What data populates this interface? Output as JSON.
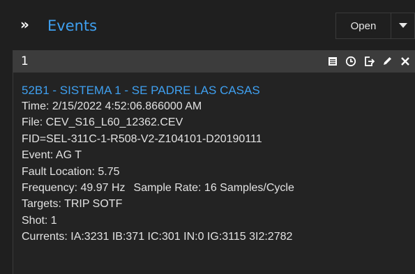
{
  "header": {
    "title": "Events",
    "open_label": "Open"
  },
  "panel": {
    "number": "1",
    "heading": "52B1 - SISTEMA 1 - SE PADRE LAS CASAS",
    "time": "Time:  2/15/2022 4:52:06.866000 AM",
    "file": "File: CEV_S16_L60_12362.CEV",
    "fid": "FID=SEL-311C-1-R508-V2-Z104101-D20190111",
    "event": "Event: AG T",
    "fault_location": "Fault Location: 5.75",
    "frequency": "Frequency: 49.97 Hz",
    "sample_rate": "Sample Rate: 16 Samples/Cycle",
    "targets": "Targets: TRIP SOTF",
    "shot": "Shot: 1",
    "currents": "Currents: IA:3231 IB:371 IC:301 IN:0 IG:3115 3I2:2782"
  },
  "icons": {
    "expand": "double-chevron-right-icon",
    "caret": "caret-down-icon",
    "tools": [
      "table-icon",
      "clock-icon",
      "export-icon",
      "edit-icon",
      "close-icon"
    ]
  },
  "colors": {
    "accent": "#3fa0f0",
    "background": "#1f1f1f",
    "header_bar": "#3c3c3c"
  }
}
